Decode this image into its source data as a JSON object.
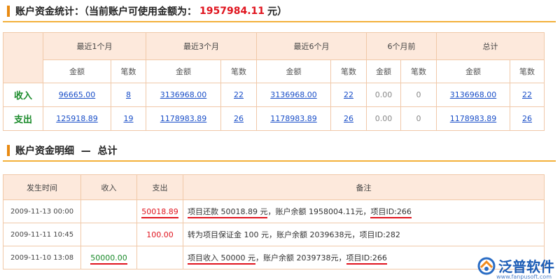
{
  "summary": {
    "title": "账户资金统计：（当前账户可使用金额为：",
    "amount": "1957984.11",
    "unit": "元）",
    "groups": [
      "最近1个月",
      "最近3个月",
      "最近6个月",
      "6个月前",
      "总计"
    ],
    "sub_headers": [
      "金额",
      "笔数"
    ],
    "rows": [
      {
        "label": "收入",
        "cells": [
          {
            "amount": "96665.00",
            "count": "8"
          },
          {
            "amount": "3136968.00",
            "count": "22"
          },
          {
            "amount": "3136968.00",
            "count": "22"
          },
          {
            "amount": "0.00",
            "count": "0"
          },
          {
            "amount": "3136968.00",
            "count": "22"
          }
        ]
      },
      {
        "label": "支出",
        "cells": [
          {
            "amount": "125918.89",
            "count": "19"
          },
          {
            "amount": "1178983.89",
            "count": "26"
          },
          {
            "amount": "1178983.89",
            "count": "26"
          },
          {
            "amount": "0.00",
            "count": "0"
          },
          {
            "amount": "1178983.89",
            "count": "26"
          }
        ]
      }
    ]
  },
  "detail": {
    "title": "账户资金明细  —  总计",
    "headers": [
      "发生时间",
      "收入",
      "支出",
      "备注"
    ],
    "rows": [
      {
        "time": "2009-11-13 00:00",
        "income": "",
        "expense": "50018.89",
        "note": [
          "项目还款  50018.89 元",
          "，账户余额  1958004.11元，",
          "项目ID:266"
        ]
      },
      {
        "time": "2009-11-11 10:45",
        "income": "",
        "expense": "100.00",
        "note": [
          "转为项目保证金  100 元",
          "，账户余额  2039638元，",
          "项目ID:282"
        ]
      },
      {
        "time": "2009-11-10 13:08",
        "income": "50000.00",
        "expense": "",
        "note": [
          "项目收入  50000 元",
          "，账户余额  2039738元，",
          "项目ID:266"
        ]
      }
    ]
  },
  "logo": {
    "name": "泛普软件",
    "url": "www.fanpusoft.com"
  },
  "colors": {
    "accent": "#f3b03a",
    "red": "#e0141e",
    "green": "#1a8a2a",
    "link": "#1a4fc8"
  }
}
